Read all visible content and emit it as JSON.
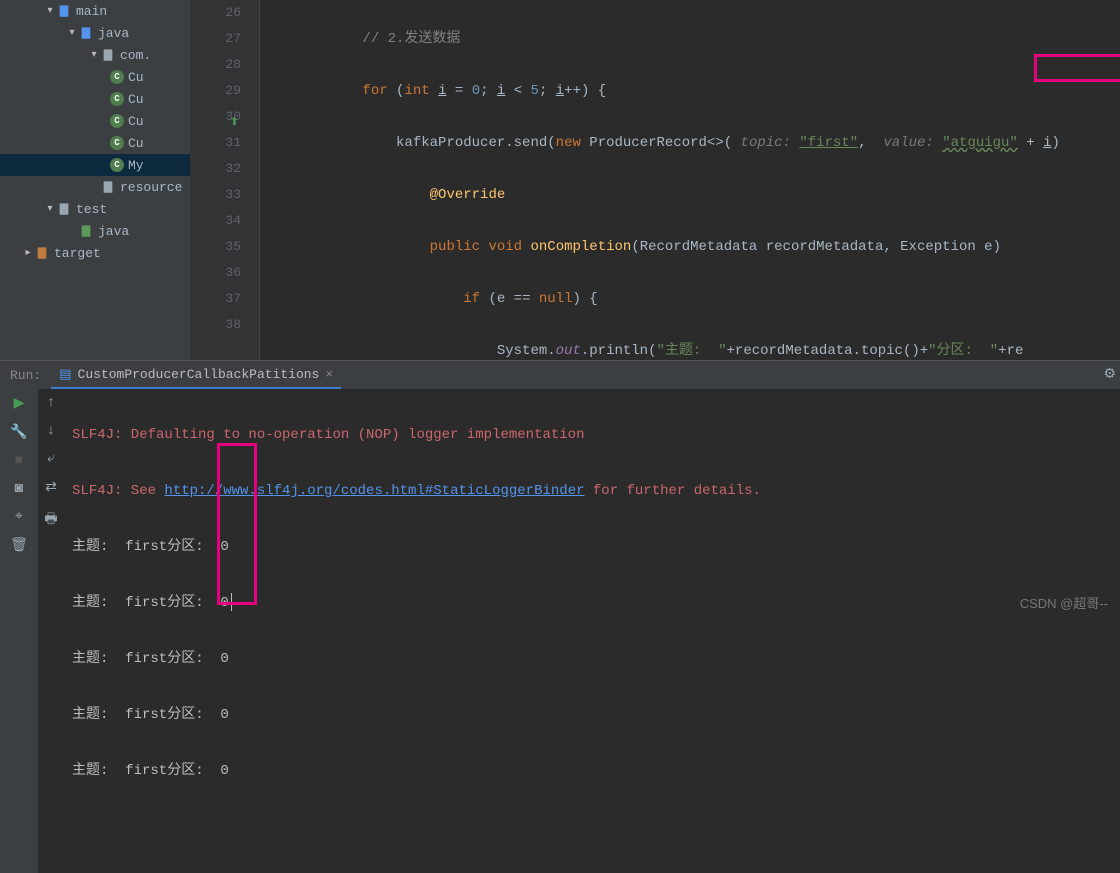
{
  "tree": {
    "main": "main",
    "java1": "java",
    "com": "com.",
    "cu1": "Cu",
    "cu2": "Cu",
    "cu3": "Cu",
    "cu4": "Cu",
    "my": "My",
    "resources": "resource",
    "test": "test",
    "java2": "java",
    "target": "target"
  },
  "gutter": [
    "26",
    "27",
    "28",
    "29",
    "30",
    "31",
    "32",
    "33",
    "34",
    "35",
    "36",
    "37",
    "38"
  ],
  "code": {
    "l26": "// 2.发送数据",
    "l30_mod": "⬆",
    "c_for": "for",
    "c_int": "int",
    "c_new": "new",
    "c_public": "public",
    "c_void": "void",
    "c_if": "if",
    "c_null": "null",
    "c_i": "i",
    "c_eq": "=",
    "c_zero": "0",
    "c_lt": "<",
    "c_five": "5",
    "c_pp": "++",
    "c_kprod": "kafkaProducer",
    "c_send": ".send(",
    "c_prec": "ProducerRecord",
    "c_diam": "<>(",
    "c_topic": "topic:",
    "c_first": "\"first\"",
    "c_comma": ", ",
    "c_value": "value:",
    "c_atg": "\"atguigu\"",
    "c_plus": " + ",
    "c_irp": "i",
    "c_over": "@Override",
    "c_oncmp": "onCompletion",
    "c_args": "(RecordMetadata recordMetadata, Exception e)",
    "c_e": "e",
    "c_eqeq": " == ",
    "c_sys": "System.",
    "c_out": "out",
    "c_println": ".println(",
    "c_zhuti": "\"主题:  \"",
    "c_plus2": "+recordMetadata.topic()+",
    "c_fenqu": "\"分区:  \"",
    "c_tail": "+re"
  },
  "run": {
    "label": "Run:",
    "tab": "CustomProducerCallbackPatitions",
    "close": "×"
  },
  "console": {
    "l1": "SLF4J: Defaulting to no-operation (NOP) logger implementation",
    "l2a": "SLF4J: See ",
    "l2b": "http://www.slf4j.org/codes.html#StaticLoggerBinder",
    "l2c": " for further details.",
    "row_prefix": "主题:  first分区:  ",
    "row_val": "0"
  },
  "watermark": "CSDN @超哥--"
}
